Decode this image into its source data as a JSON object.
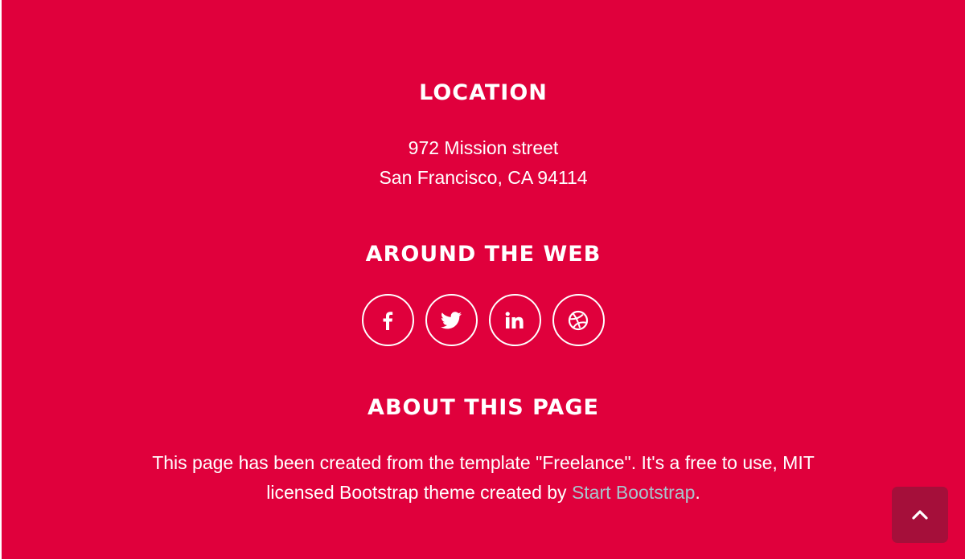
{
  "location": {
    "title": "LOCATION",
    "address_line1": "972 Mission street",
    "address_line2": "San Francisco, CA 94114"
  },
  "web": {
    "title": "AROUND THE WEB",
    "links": [
      {
        "icon": "facebook-icon"
      },
      {
        "icon": "twitter-icon"
      },
      {
        "icon": "linkedin-icon"
      },
      {
        "icon": "dribbble-icon"
      }
    ]
  },
  "about": {
    "title": "ABOUT THIS PAGE",
    "text_line1": "This page has been created from the template \"Freelance\". It's a free to use, MIT",
    "text_line2_prefix": "licensed Bootstrap theme created by ",
    "link_label": "Start Bootstrap",
    "text_line2_suffix": "."
  },
  "scroll_top": {
    "icon": "chevron-up-icon"
  },
  "colors": {
    "background": "#e0003c",
    "link": "#a7c4cc",
    "scroll_button": "#a50f3a",
    "text": "#ffffff"
  }
}
